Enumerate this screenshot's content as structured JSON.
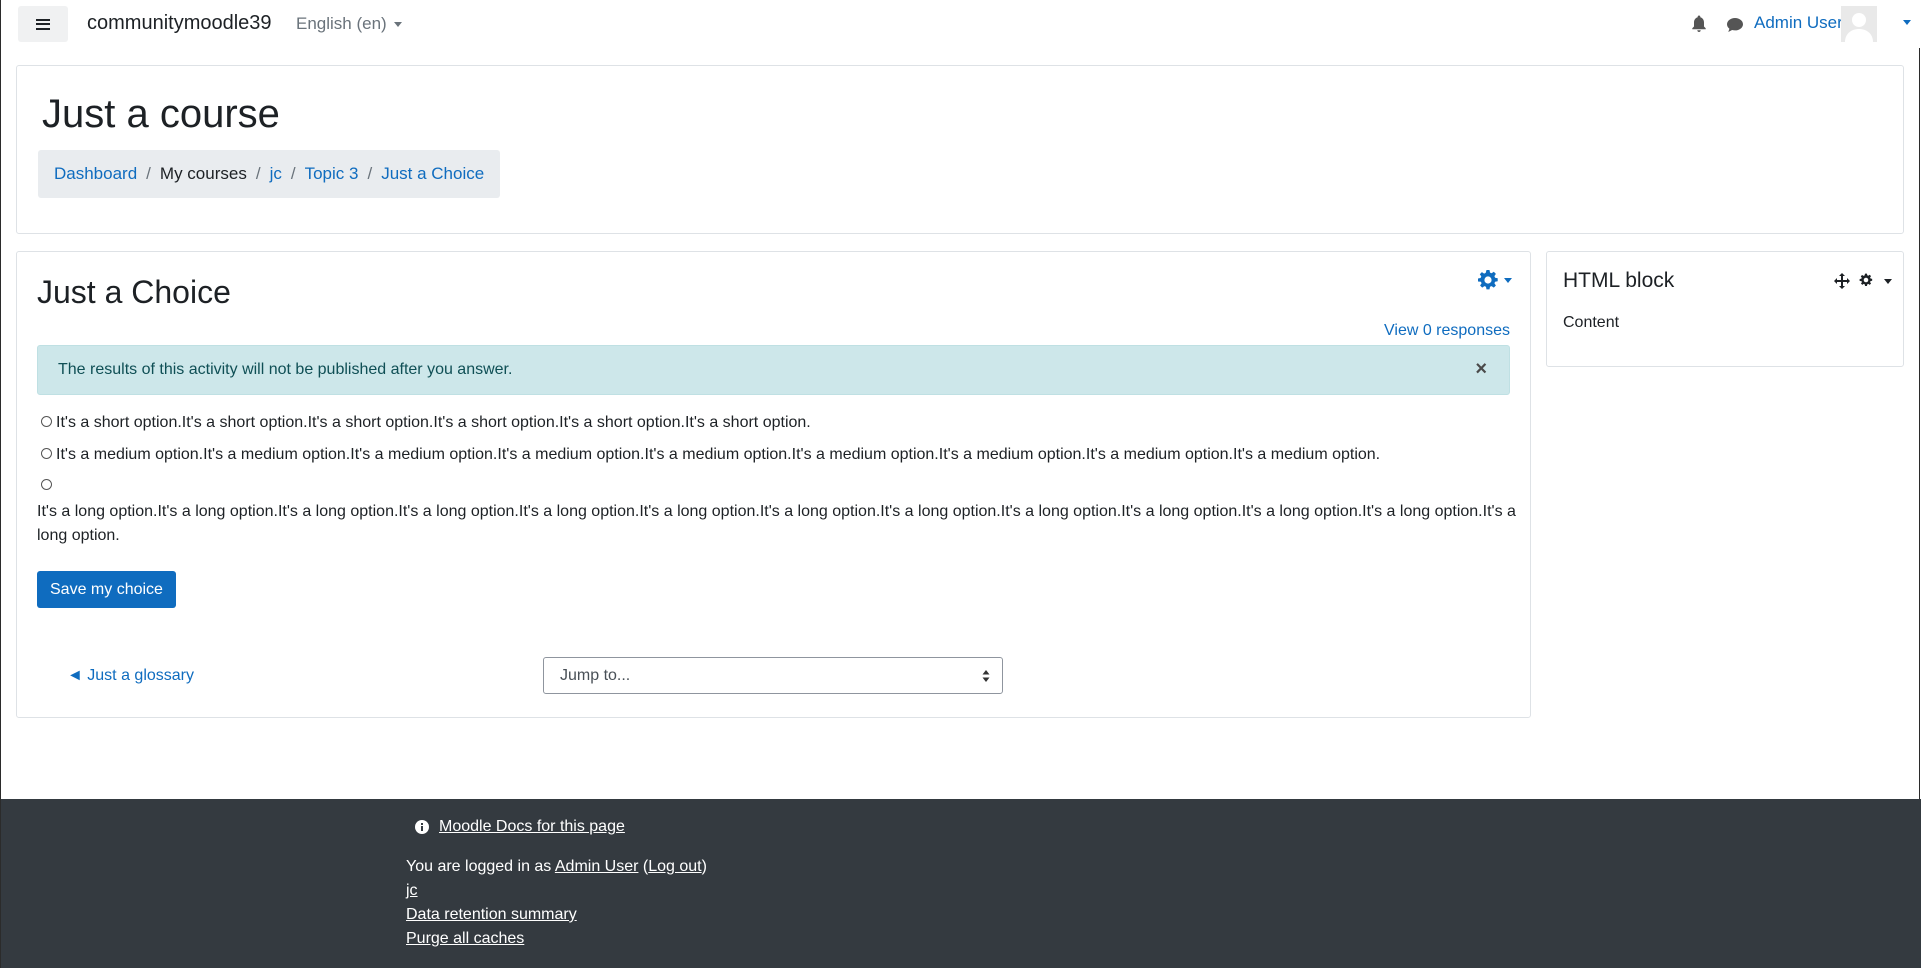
{
  "navbar": {
    "site_name": "communitymoodle39",
    "language": "English (en)",
    "user_name": "Admin User",
    "icons": [
      "hamburger-icon",
      "bell-icon",
      "chat-icon",
      "avatar-icon"
    ]
  },
  "header": {
    "course_title": "Just a course",
    "breadcrumb": {
      "dashboard": "Dashboard",
      "my_courses": "My courses",
      "jc": "jc",
      "topic": "Topic 3",
      "current": "Just a Choice",
      "separator": "/"
    }
  },
  "main": {
    "title": "Just a Choice",
    "view_responses": "View 0 responses",
    "alert": "The results of this activity will not be published after you answer.",
    "alert_close": "×",
    "options": {
      "short": "It's a short option.It's a short option.It's a short option.It's a short option.It's a short option.It's a short option.",
      "medium": "It's a medium option.It's a medium option.It's a medium option.It's a medium option.It's a medium option.It's a medium option.It's a medium option.It's a medium option.It's a medium option.",
      "long": "It's a long option.It's a long option.It's a long option.It's a long option.It's a long option.It's a long option.It's a long option.It's a long option.It's a long option.It's a long option.It's a long option.It's a long option.It's a long option."
    },
    "save_button": "Save my choice",
    "prev_activity": "◄ Just a glossary",
    "jump_to": "Jump to..."
  },
  "block": {
    "title": "HTML block",
    "content": "Content"
  },
  "footer": {
    "docs_link": "Moodle Docs for this page",
    "logged_in_prefix": "You are logged in as ",
    "logged_in_user": "Admin User",
    "open_paren": " (",
    "logout": "Log out",
    "close_paren": ")",
    "jc_link": "jc",
    "data_retention": "Data retention summary",
    "purge_caches": "Purge all caches"
  },
  "colors": {
    "primary": "#0f6cbf",
    "alert_bg": "#cde7ea",
    "footer_bg": "#343a40",
    "breadcrumb_bg": "#e9ecef"
  }
}
